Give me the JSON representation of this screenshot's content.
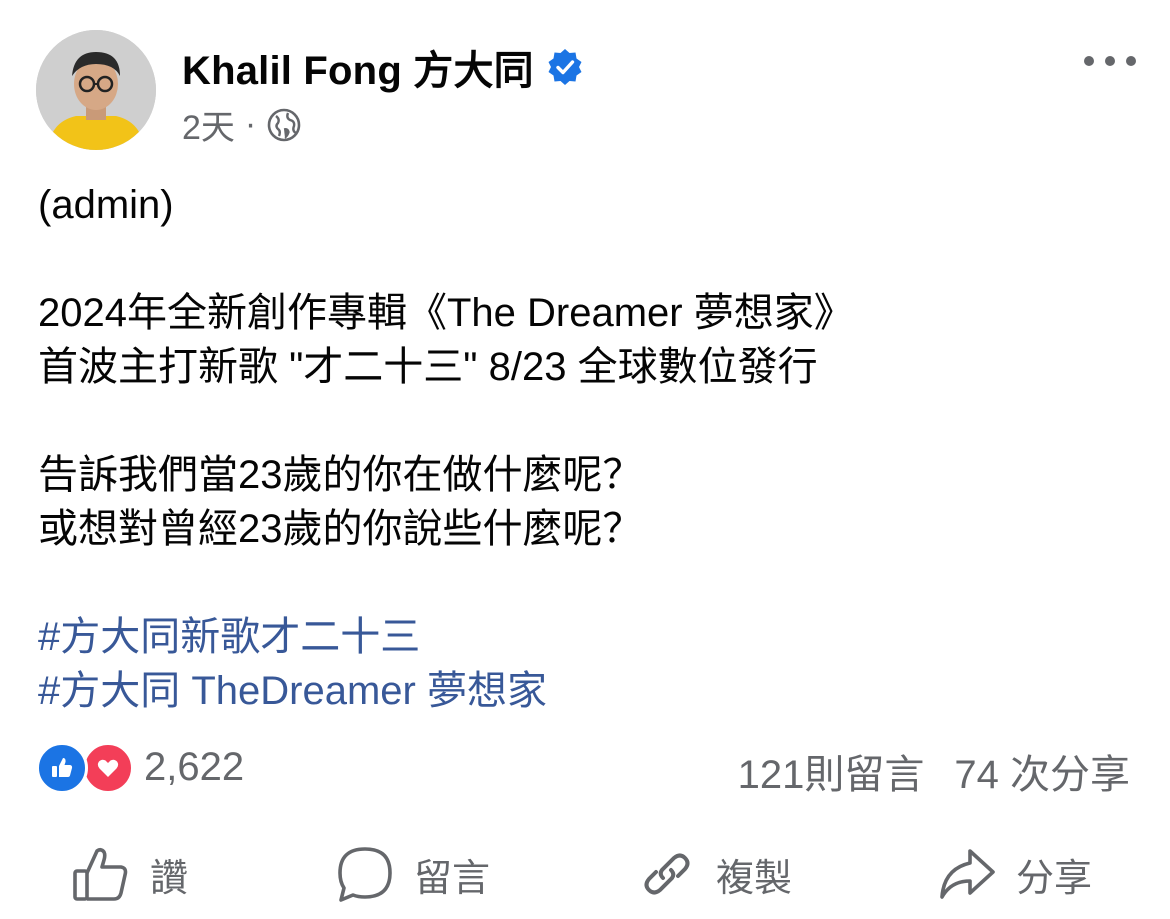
{
  "author": {
    "name": "Khalil Fong 方大同",
    "verified": true
  },
  "meta": {
    "time": "2天",
    "separator": "·",
    "audience_icon": "globe-icon"
  },
  "post": {
    "lines": [
      "(admin)",
      "",
      "2024年全新創作專輯《The Dreamer 夢想家》",
      "首波主打新歌 \"才二十三\" 8/23 全球數位發行",
      "",
      "告訴我們當23歲的你在做什麼呢？",
      "或想對曾經23歲的你說些什麼呢？",
      ""
    ],
    "hashtags": [
      "#方大同新歌才二十三",
      "#方大同 TheDreamer 夢想家"
    ]
  },
  "reactions": {
    "icons": [
      "like-reaction-icon",
      "love-reaction-icon"
    ],
    "count": "2,622"
  },
  "stats": {
    "comments": "121則留言",
    "shares": "74 次分享"
  },
  "actions": {
    "like": "讚",
    "comment": "留言",
    "copy": "複製",
    "share": "分享"
  },
  "colors": {
    "text": "#050505",
    "secondary": "#65676b",
    "link": "#385898",
    "verified": "#1b74e4",
    "like": "#1b74e4",
    "love": "#f33e58"
  }
}
